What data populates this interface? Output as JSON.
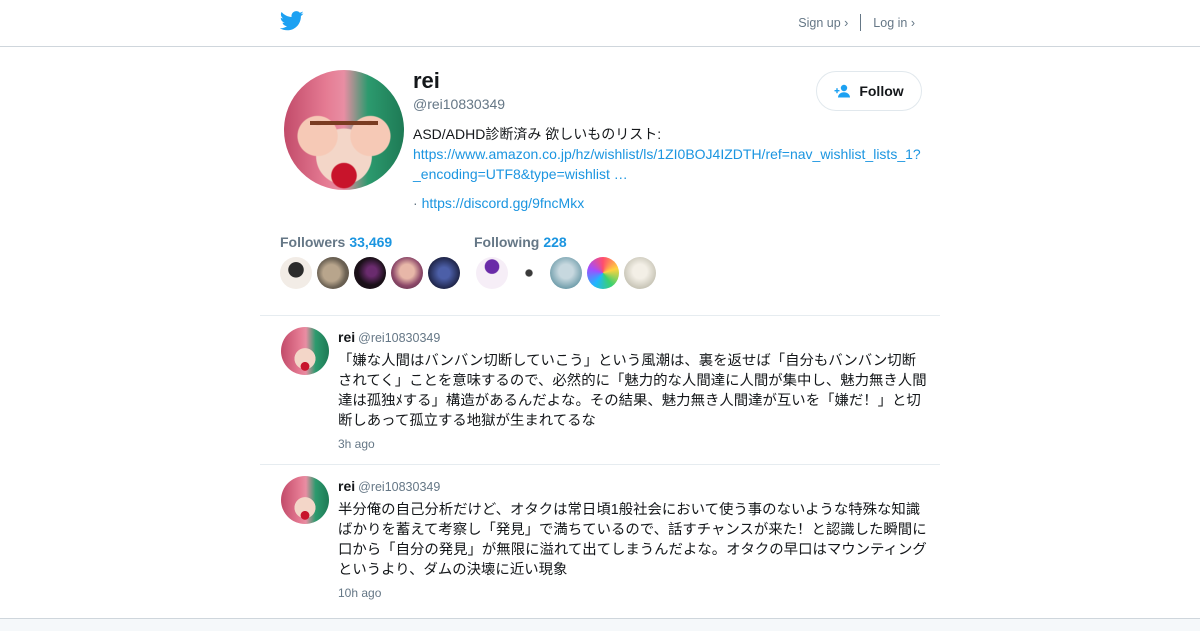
{
  "header": {
    "logo_icon": "twitter-bird-icon",
    "signup_label": "Sign up ›",
    "login_label": "Log in ›",
    "brand_color": "#1da1f2"
  },
  "profile": {
    "name": "rei",
    "handle": "@rei10830349",
    "bio_text": "ASD/ADHD診断済み 欲しいものリスト:",
    "bio_link1": "https://www.amazon.co.jp/hz/wishlist/ls/1ZI0BOJ4IZDTH/ref=nav_wishlist_lists_1?_encoding=UTF8&type=wishlist …",
    "bio_dot": "·",
    "bio_link2": "https://discord.gg/9fncMkx",
    "follow_label": "Follow",
    "follow_icon": "add-user-icon"
  },
  "stats": {
    "followers_label": "Followers",
    "followers_count": "33,469",
    "following_label": "Following",
    "following_count": "228"
  },
  "tweets": [
    {
      "name": "rei",
      "handle": "@rei10830349",
      "text": "「嫌な人間はバンバン切断していこう」という風潮は、裏を返せば「自分もバンバン切断されてく」ことを意味するので、必然的に「魅力的な人間達に人間が集中し、魅力無き人間達は孤独ﾒする」構造があるんだよな。その結果、魅力無き人間達が互いを「嫌だ！」と切断しあって孤立する地獄が生まれてるな",
      "time": "3h ago"
    },
    {
      "name": "rei",
      "handle": "@rei10830349",
      "text": "半分俺の自己分析だけど、オタクは常日頃1般社会において使う事のないような特殊な知識ばかりを蓄えて考察し「発見」で満ちているので、話すチャンスが来た！と認識した瞬間に口から「自分の発見」が無限に溢れて出てしまうんだよな。オタクの早口はマウンティングというより、ダムの決壊に近い現象",
      "time": "10h ago"
    }
  ]
}
